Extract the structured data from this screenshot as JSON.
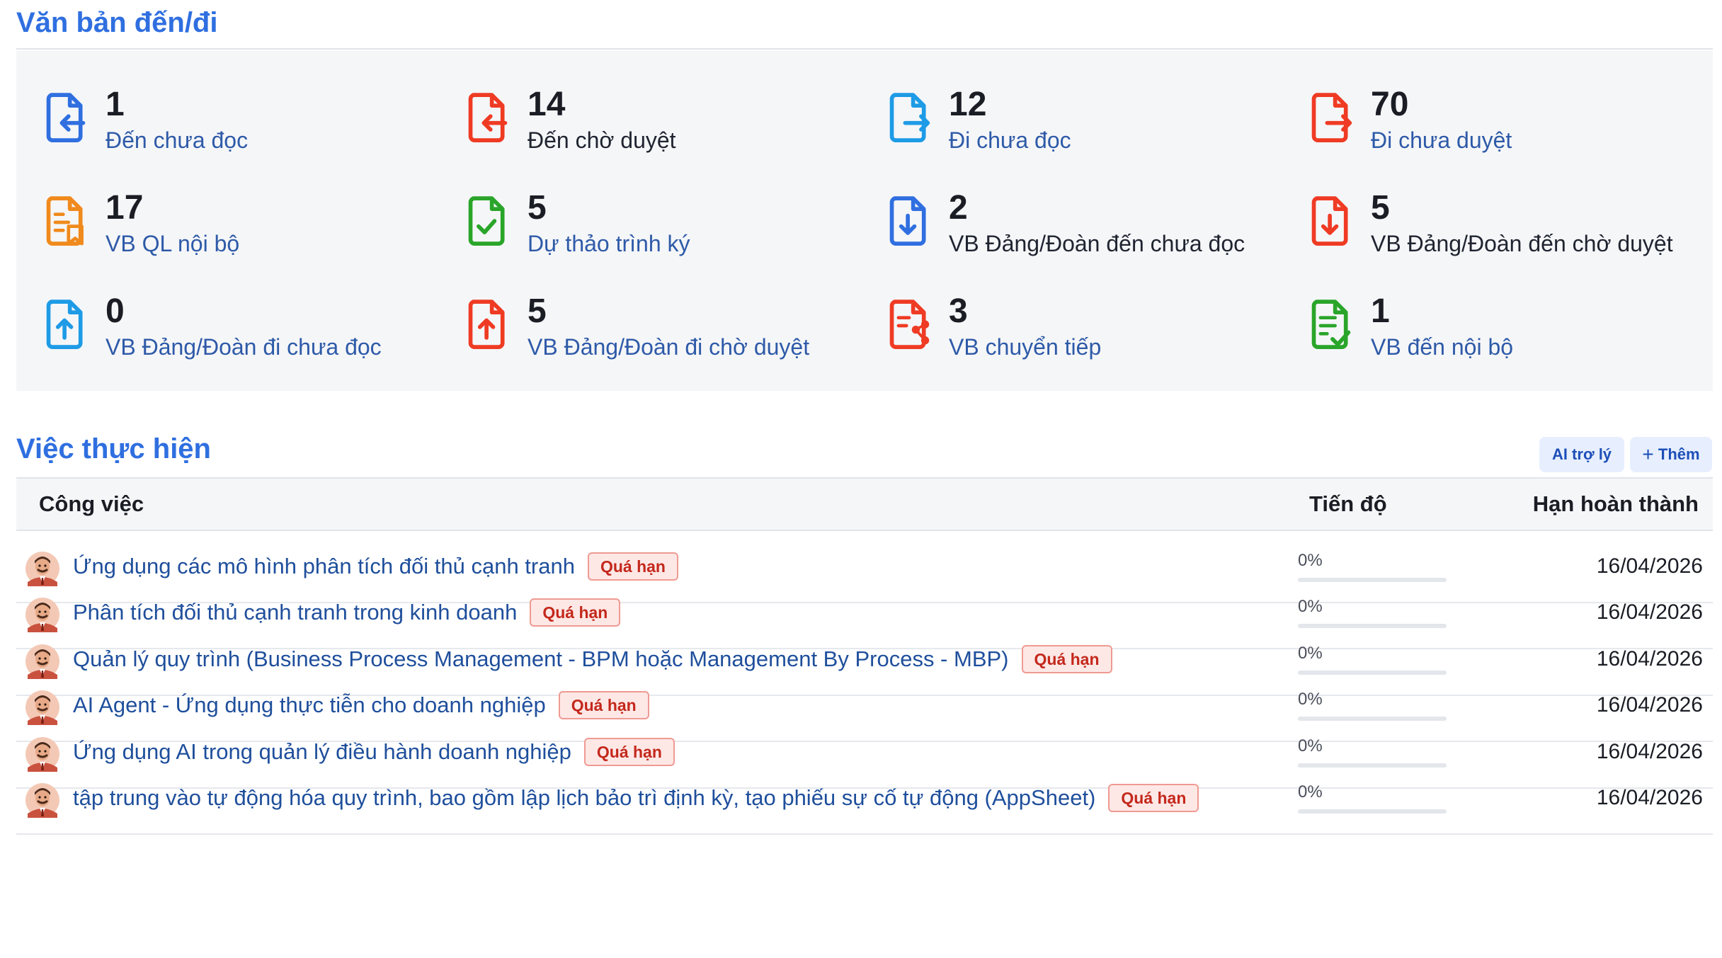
{
  "docs": {
    "title": "Văn bản đến/đi",
    "stats": [
      {
        "count": "1",
        "label": "Đến chưa đọc",
        "icon": "incoming-doc-icon",
        "color": "#2f6fe0"
      },
      {
        "count": "14",
        "label": "Đến chờ duyệt",
        "icon": "incoming-doc-icon",
        "color": "#ef3b24"
      },
      {
        "count": "12",
        "label": "Đi chưa đọc",
        "icon": "outgoing-doc-icon",
        "color": "#1e9be6"
      },
      {
        "count": "70",
        "label": "Đi chưa duyệt",
        "icon": "outgoing-doc-icon",
        "color": "#ef3b24"
      },
      {
        "count": "17",
        "label": "VB QL nội bộ",
        "icon": "internal-doc-icon",
        "color": "#f08a1c"
      },
      {
        "count": "5",
        "label": "Dự thảo trình ký",
        "icon": "check-doc-icon",
        "color": "#2aa52a"
      },
      {
        "count": "2",
        "label": "VB Đảng/Đoàn đến chưa đọc",
        "icon": "download-doc-icon",
        "color": "#2f6fe0"
      },
      {
        "count": "5",
        "label": "VB Đảng/Đoàn đến chờ duyệt",
        "icon": "download-doc-icon",
        "color": "#ef3b24"
      },
      {
        "count": "0",
        "label": "VB Đảng/Đoàn đi chưa đọc",
        "icon": "upload-doc-icon",
        "color": "#1e9be6"
      },
      {
        "count": "5",
        "label": "VB Đảng/Đoàn đi chờ duyệt",
        "icon": "upload-doc-icon",
        "color": "#ef3b24"
      },
      {
        "count": "3",
        "label": "VB chuyển tiếp",
        "icon": "share-doc-icon",
        "color": "#ef3b24"
      },
      {
        "count": "1",
        "label": "VB đến nội bộ",
        "icon": "checklist-doc-icon",
        "color": "#2aa52a"
      }
    ]
  },
  "tasks": {
    "title": "Việc thực hiện",
    "ai_button": "AI trợ lý",
    "add_button": "Thêm",
    "columns": {
      "task": "Công việc",
      "progress": "Tiến độ",
      "due": "Hạn hoàn thành"
    },
    "overdue_badge": "Quá hạn",
    "rows": [
      {
        "name": "Ứng dụng các mô hình phân tích đối thủ cạnh tranh",
        "progress": "0%",
        "progress_value": 0,
        "due": "16/04/2026"
      },
      {
        "name": "Phân tích đối thủ cạnh tranh trong kinh doanh",
        "progress": "0%",
        "progress_value": 0,
        "due": "16/04/2026"
      },
      {
        "name": "Quản lý quy trình (Business Process Management - BPM hoặc Management By Process - MBP)",
        "progress": "0%",
        "progress_value": 0,
        "due": "16/04/2026"
      },
      {
        "name": "AI Agent - Ứng dụng thực tiễn cho doanh nghiệp",
        "progress": "0%",
        "progress_value": 0,
        "due": "16/04/2026"
      },
      {
        "name": "Ứng dụng AI trong quản lý điều hành doanh nghiệp",
        "progress": "0%",
        "progress_value": 0,
        "due": "16/04/2026"
      },
      {
        "name": "tập trung vào tự động hóa quy trình, bao gồm lập lịch bảo trì định kỳ, tạo phiếu sự cố tự động (AppSheet)",
        "progress": "0%",
        "progress_value": 0,
        "due": "16/04/2026"
      }
    ]
  }
}
